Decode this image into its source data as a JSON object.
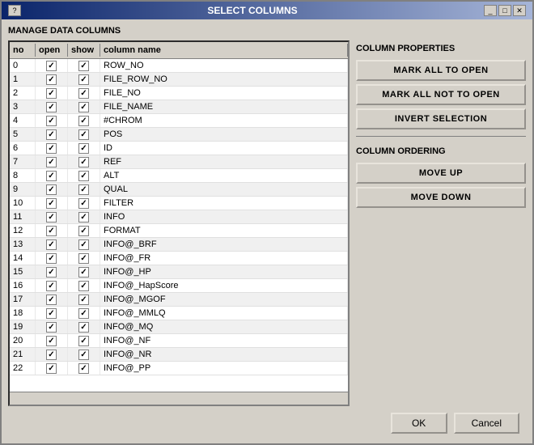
{
  "window": {
    "title": "SELECT COLUMNS",
    "title_buttons": [
      "?",
      "^",
      "X"
    ]
  },
  "manage_section": {
    "label": "MANAGE DATA COLUMNS"
  },
  "table": {
    "headers": [
      "no",
      "open",
      "show",
      "column name"
    ],
    "rows": [
      {
        "no": "0",
        "open": true,
        "show": true,
        "name": "ROW_NO"
      },
      {
        "no": "1",
        "open": true,
        "show": true,
        "name": "FILE_ROW_NO"
      },
      {
        "no": "2",
        "open": true,
        "show": true,
        "name": "FILE_NO"
      },
      {
        "no": "3",
        "open": true,
        "show": true,
        "name": "FILE_NAME"
      },
      {
        "no": "4",
        "open": true,
        "show": true,
        "name": "#CHROM"
      },
      {
        "no": "5",
        "open": true,
        "show": true,
        "name": "POS"
      },
      {
        "no": "6",
        "open": true,
        "show": true,
        "name": "ID"
      },
      {
        "no": "7",
        "open": true,
        "show": true,
        "name": "REF"
      },
      {
        "no": "8",
        "open": true,
        "show": true,
        "name": "ALT"
      },
      {
        "no": "9",
        "open": true,
        "show": true,
        "name": "QUAL"
      },
      {
        "no": "10",
        "open": true,
        "show": true,
        "name": "FILTER"
      },
      {
        "no": "11",
        "open": true,
        "show": true,
        "name": "INFO"
      },
      {
        "no": "12",
        "open": true,
        "show": true,
        "name": "FORMAT"
      },
      {
        "no": "13",
        "open": true,
        "show": true,
        "name": "INFO@_BRF"
      },
      {
        "no": "14",
        "open": true,
        "show": true,
        "name": "INFO@_FR"
      },
      {
        "no": "15",
        "open": true,
        "show": true,
        "name": "INFO@_HP"
      },
      {
        "no": "16",
        "open": true,
        "show": true,
        "name": "INFO@_HapScore"
      },
      {
        "no": "17",
        "open": true,
        "show": true,
        "name": "INFO@_MGOF"
      },
      {
        "no": "18",
        "open": true,
        "show": true,
        "name": "INFO@_MMLQ"
      },
      {
        "no": "19",
        "open": true,
        "show": true,
        "name": "INFO@_MQ"
      },
      {
        "no": "20",
        "open": true,
        "show": true,
        "name": "INFO@_NF"
      },
      {
        "no": "21",
        "open": true,
        "show": true,
        "name": "INFO@_NR"
      },
      {
        "no": "22",
        "open": true,
        "show": true,
        "name": "INFO@_PP"
      }
    ]
  },
  "column_properties": {
    "label": "COLUMN PROPERTIES",
    "mark_all_open": "MARK ALL TO OPEN",
    "mark_not_open": "MARK ALL NOT TO OPEN",
    "invert_selection": "INVERT SELECTION"
  },
  "column_ordering": {
    "label": "COLUMN ORDERING",
    "move_up": "MOVE UP",
    "move_down": "MOVE DOWN"
  },
  "footer": {
    "ok": "OK",
    "cancel": "Cancel"
  }
}
